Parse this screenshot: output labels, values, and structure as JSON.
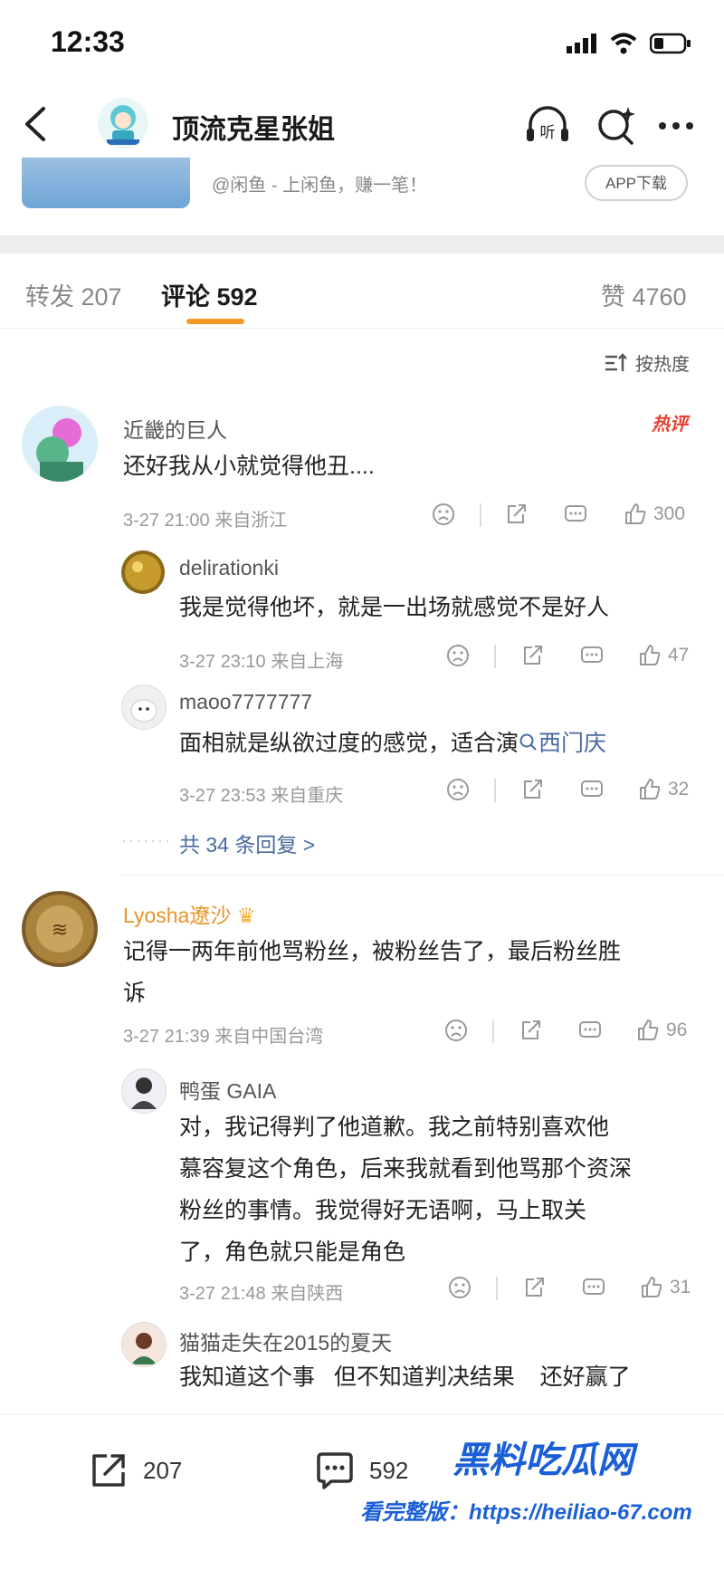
{
  "status": {
    "time": "12:33"
  },
  "header": {
    "title": "顶流克星张姐",
    "listen_label": "听"
  },
  "banner": {
    "text": "@闲鱼 - 上闲鱼，赚一笔！",
    "button": "APP下载"
  },
  "tabs": [
    {
      "label": "转发 207"
    },
    {
      "label": "评论 592"
    },
    {
      "label": "赞 4760"
    }
  ],
  "sort": {
    "label": "按热度"
  },
  "hot_badge": "热评",
  "comments": [
    {
      "user": "近畿的巨人",
      "text": "还好我从小就觉得他丑....",
      "meta": "3-27 21:00 来自浙江",
      "likes": "300"
    },
    {
      "user": "delirationki",
      "text": "我是觉得他坏，就是一出场就感觉不是好人",
      "meta": "3-27 23:10 来自上海",
      "likes": "47"
    },
    {
      "user": "maoo7777777",
      "text_prefix": "面相就是纵欲过度的感觉，适合演",
      "link": "西门庆",
      "meta": "3-27 23:53 来自重庆",
      "likes": "32"
    },
    {
      "user": "Lyosha遼沙",
      "text1": "记得一两年前他骂粉丝，被粉丝告了，最后粉丝胜",
      "text2": "诉",
      "meta": "3-27 21:39 来自中国台湾",
      "likes": "96"
    },
    {
      "user": "鸭蛋 GAIA",
      "text1": "对，我记得判了他道歉。我之前特别喜欢他",
      "text2": "慕容复这个角色，后来我就看到他骂那个资深",
      "text3": "粉丝的事情。我觉得好无语啊，马上取关",
      "text4": "了，角色就只能是角色",
      "meta": "3-27 21:48 来自陕西",
      "likes": "31"
    },
    {
      "user": "猫猫走失在2015的夏天",
      "text": "我知道这个事   但不知道判决结果    还好赢了"
    }
  ],
  "more_replies": "共 34 条回复 >",
  "bottom": {
    "repost_count": "207",
    "comment_count": "592"
  },
  "watermark": {
    "line1": "黑料吃瓜网",
    "line2": "看完整版：https://heiliao-67.com"
  },
  "colors": {
    "accent": "#f49a26",
    "link": "#4a6aa0",
    "hot": "#e8402f",
    "watermark": "#1a5fd6"
  }
}
